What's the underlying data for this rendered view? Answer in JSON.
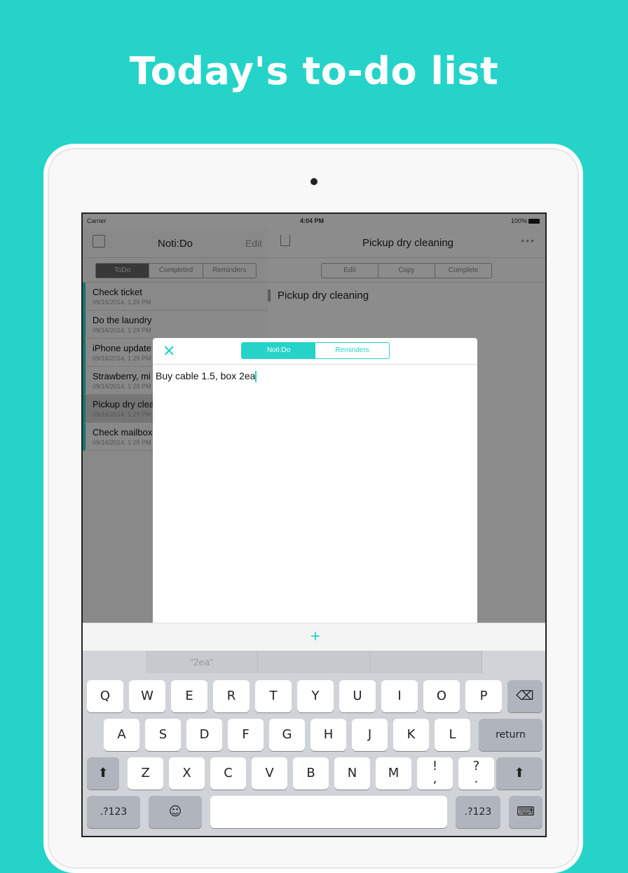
{
  "headline": "Today's to-do list",
  "status": {
    "carrier": "Carrier",
    "time": "4:04 PM",
    "battery": "100%"
  },
  "left": {
    "title": "Noti:Do",
    "edit": "Edit",
    "tabs": [
      "ToDo",
      "Completed",
      "Reminders"
    ],
    "items": [
      {
        "title": "Check ticket",
        "date": "09/16/2014, 1:29 PM"
      },
      {
        "title": "Do the laundry",
        "date": "09/16/2014, 1:29 PM"
      },
      {
        "title": "iPhone update",
        "date": "09/16/2014, 1:29 PM"
      },
      {
        "title": "Strawberry, mi",
        "date": "09/16/2014, 1:29 PM"
      },
      {
        "title": "Pickup dry clea",
        "date": "09/16/2014, 1:29 PM"
      },
      {
        "title": "Check mailbox",
        "date": "09/16/2014, 1:29 PM"
      }
    ]
  },
  "right": {
    "title": "Pickup dry cleaning",
    "more": "•••",
    "tabs": [
      "Edit",
      "Copy",
      "Complete"
    ],
    "content": "Pickup dry cleaning"
  },
  "modal": {
    "tabs": [
      "Noti:Do",
      "Reminders"
    ],
    "text": "Buy cable 1.5, box 2ea"
  },
  "plus": "+",
  "keyboard": {
    "suggestions": [
      "\"2ea\"",
      "",
      ""
    ],
    "row1": [
      "Q",
      "W",
      "E",
      "R",
      "T",
      "Y",
      "U",
      "I",
      "O",
      "P"
    ],
    "row2": [
      "A",
      "S",
      "D",
      "F",
      "G",
      "H",
      "J",
      "K",
      "L"
    ],
    "row3": [
      "Z",
      "X",
      "C",
      "V",
      "B",
      "N",
      "M",
      "!\n,",
      "?\n."
    ],
    "return": "return",
    "numbers": ".?123",
    "emoji": "☺",
    "keyboard_icon": "⌨"
  }
}
